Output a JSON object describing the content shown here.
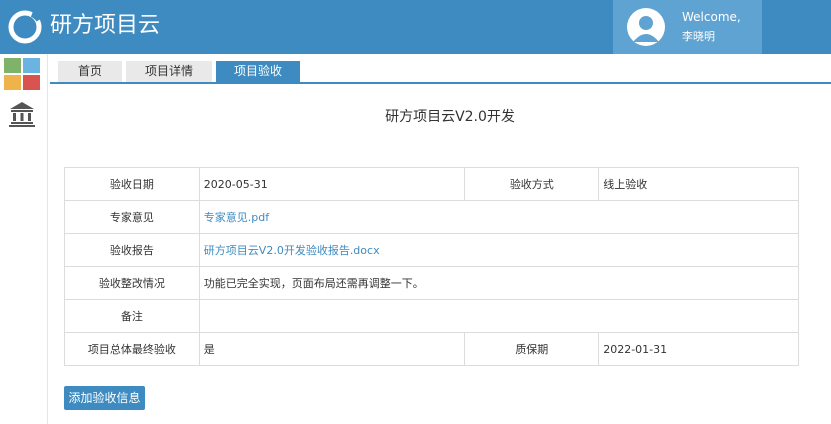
{
  "app": {
    "title": "研方项目云"
  },
  "user": {
    "welcome": "Welcome,",
    "name": "李晓明"
  },
  "tabs": [
    {
      "label": "首页",
      "active": false
    },
    {
      "label": "项目详情",
      "active": false
    },
    {
      "label": "项目验收",
      "active": true
    }
  ],
  "document": {
    "title": "研方项目云V2.0开发"
  },
  "acceptance": {
    "date_label": "验收日期",
    "date_value": "2020-05-31",
    "method_label": "验收方式",
    "method_value": "线上验收",
    "expert_label": "专家意见",
    "expert_file": "专家意见.pdf",
    "report_label": "验收报告",
    "report_file": "研方项目云V2.0开发验收报告.docx",
    "rectify_label": "验收整改情况",
    "rectify_value": "功能已完全实现，页面布局还需再调整一下。",
    "remark_label": "备注",
    "remark_value": "",
    "final_label": "项目总体最终验收",
    "final_value": "是",
    "warranty_label": "质保期",
    "warranty_value": "2022-01-31"
  },
  "actions": {
    "add_label": "添加验收信息"
  },
  "colors": {
    "primary": "#3d8bc0",
    "user_box": "#5fa3d2",
    "tile_green": "#7fb36a",
    "tile_blue": "#6bb3e0",
    "tile_orange": "#f0b34a",
    "tile_red": "#d9534f"
  },
  "icons": [
    "logo-icon",
    "user-avatar-icon",
    "apps-grid-icon",
    "bank-icon"
  ]
}
